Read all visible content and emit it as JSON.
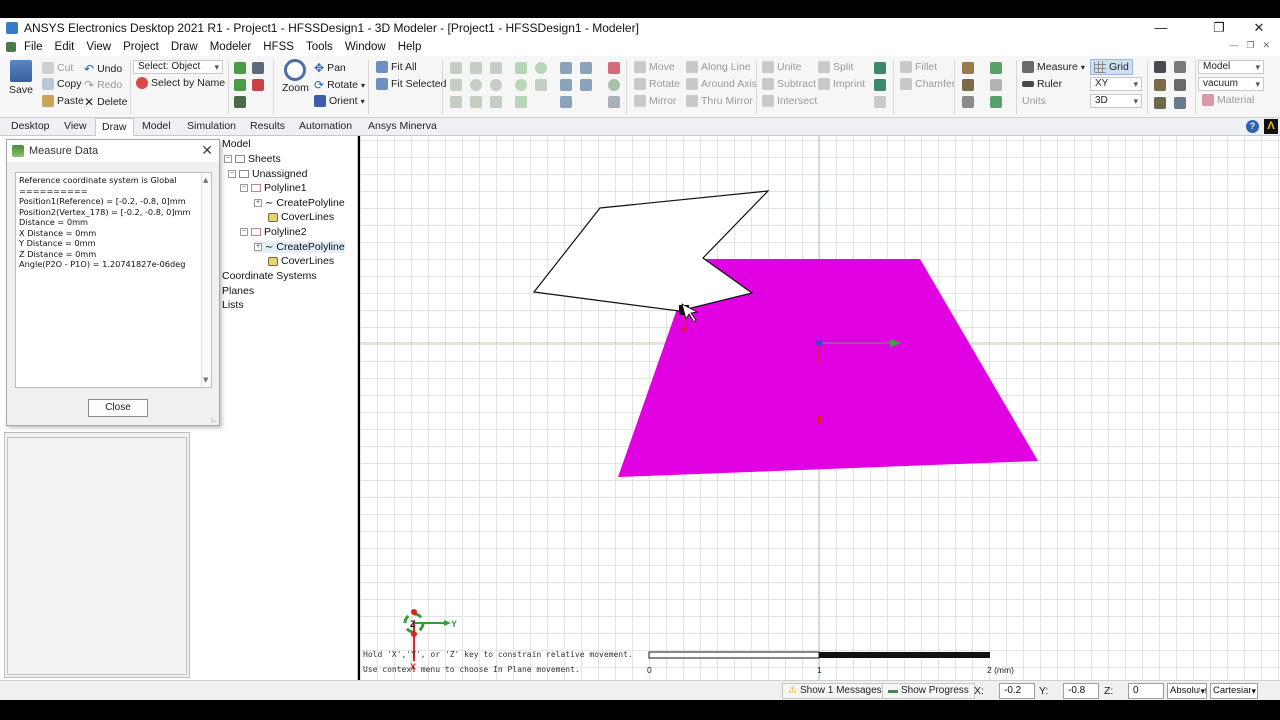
{
  "window": {
    "title": "ANSYS Electronics Desktop 2021 R1 - Project1 - HFSSDesign1 - 3D Modeler - [Project1 - HFSSDesign1 - Modeler]"
  },
  "menu": [
    "File",
    "Edit",
    "View",
    "Project",
    "Draw",
    "Modeler",
    "HFSS",
    "Tools",
    "Window",
    "Help"
  ],
  "ribbon": {
    "save": "Save",
    "cut": "Cut",
    "copy": "Copy",
    "paste": "Paste",
    "undo": "Undo",
    "redo": "Redo",
    "delete": "Delete",
    "select_value": "Select: Object",
    "select_by_name": "Select by Name",
    "zoom": "Zoom",
    "pan": "Pan",
    "rotate": "Rotate",
    "orient": "Orient",
    "fit_all": "Fit All",
    "fit_selected": "Fit Selected",
    "move": "Move",
    "rotate2": "Rotate",
    "mirror": "Mirror",
    "along_line": "Along Line",
    "around_axis": "Around Axis",
    "thru_mirror": "Thru Mirror",
    "unite": "Unite",
    "subtract": "Subtract",
    "intersect": "Intersect",
    "split": "Split",
    "imprint": "Imprint",
    "fillet": "Fillet",
    "chamfer": "Chamfer",
    "measure": "Measure",
    "ruler": "Ruler",
    "units": "Units",
    "grid": "Grid",
    "plane_value": "XY",
    "view_mode_value": "3D",
    "model_value": "Model",
    "material_value": "vacuum",
    "material": "Material"
  },
  "tabs": [
    "Desktop",
    "View",
    "Draw",
    "Model",
    "Simulation",
    "Results",
    "Automation",
    "Ansys Minerva"
  ],
  "tree": {
    "model": "Model",
    "sheets": "Sheets",
    "unassigned": "Unassigned",
    "polyline1": "Polyline1",
    "create_polyline1": "CreatePolyline",
    "cover_lines1": "CoverLines",
    "polyline2": "Polyline2",
    "create_polyline2": "CreatePolyline",
    "cover_lines2": "CoverLines",
    "coordinate_systems": "Coordinate Systems",
    "planes": "Planes",
    "lists": "Lists"
  },
  "measure_dialog": {
    "title": "Measure Data",
    "lines": [
      "Reference coordinate system is Global",
      "==========",
      "Position1(Reference) = [-0.2, -0.8, 0]mm",
      "Position2(Vertex_178) = [-0.2, -0.8, 0]mm",
      "Distance = 0mm",
      "X Distance = 0mm",
      "Y Distance = 0mm",
      "Z Distance = 0mm",
      "Angle(P2O - P1O) = 1.20741827e-06deg"
    ],
    "close_label": "Close"
  },
  "viewport": {
    "hint_line1": "Hold 'X','Y', or 'Z' key to constrain relative movement.",
    "hint_line2": "Use context menu to choose In Plane movement.",
    "scale_labels": [
      "0",
      "1",
      "2 (mm)"
    ],
    "axis_z": "Z",
    "axis_y": "Y",
    "axis_x": "X",
    "fill_color": "#e100e1"
  },
  "status": {
    "messages": "Show 1 Messages",
    "progress": "Show Progress",
    "x_label": "X:",
    "x_value": "-0.2",
    "y_label": "Y:",
    "y_value": "-0.8",
    "z_label": "Z:",
    "z_value": "0",
    "mode_value": "Absolute",
    "coord_type_value": "Cartesian"
  }
}
